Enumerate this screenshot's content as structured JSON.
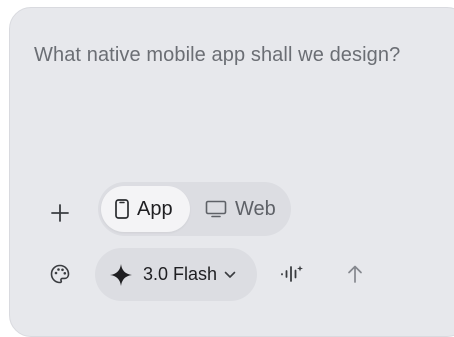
{
  "composer": {
    "placeholder": "What native mobile app shall we design?"
  },
  "toolbar": {
    "add_icon": "plus-icon",
    "mode_options": [
      {
        "label": "App",
        "icon": "phone-icon",
        "selected": true
      },
      {
        "label": "Web",
        "icon": "monitor-icon",
        "selected": false
      }
    ],
    "theme_icon": "palette-icon",
    "model": {
      "label": "3.0 Flash",
      "icon": "sparkle-icon"
    },
    "voice_icon": "voice-waveform-icon",
    "send_icon": "arrow-up-icon"
  },
  "colors": {
    "card_bg": "#e7e8ec",
    "chip_bg": "#dcdde2",
    "selected_bg": "#f4f4f6",
    "text_muted": "#6b6e74",
    "text_dark": "#1f1f22"
  }
}
